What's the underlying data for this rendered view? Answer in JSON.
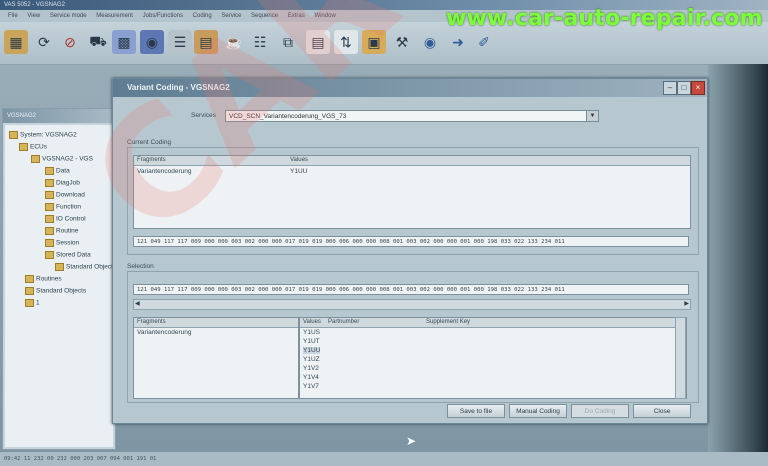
{
  "app": {
    "title": "VAS 5052 - VGSNAG2",
    "menu": [
      "File",
      "View",
      "Service mode",
      "Measurement",
      "Jobs/Functions",
      "Coding",
      "Service",
      "Sequence",
      "Extras",
      "Window"
    ]
  },
  "watermark": {
    "url": "www.car-auto-repair.com",
    "brand": "CARTOOL"
  },
  "tree": {
    "title": "VGSNAG2",
    "nodes": [
      {
        "label": "System: VGSNAG2",
        "depth": 0
      },
      {
        "label": "ECUs",
        "depth": 1
      },
      {
        "label": "VGSNAG2 - VGS",
        "depth": 2
      },
      {
        "label": "Data",
        "depth": 3
      },
      {
        "label": "DiagJob",
        "depth": 3
      },
      {
        "label": "Download",
        "depth": 3
      },
      {
        "label": "Function",
        "depth": 3
      },
      {
        "label": "IO Control",
        "depth": 3
      },
      {
        "label": "Routine",
        "depth": 3
      },
      {
        "label": "Session",
        "depth": 3
      },
      {
        "label": "Stored Data",
        "depth": 3
      },
      {
        "label": "Standard Object",
        "depth": 3
      },
      {
        "label": "Routines",
        "depth": 1
      },
      {
        "label": "Standard Objects",
        "depth": 1
      },
      {
        "label": "1",
        "depth": 1
      }
    ]
  },
  "dialog": {
    "title": "Variant Coding - VGSNAG2",
    "services_label": "Services",
    "services_value": "VCD_SCN_Variantencoderung_VGS_73",
    "current_coding": {
      "label": "Current Coding",
      "headers": [
        "Fragments",
        "Values"
      ],
      "rows": [
        [
          "Variantencoderung",
          "Y1UU"
        ]
      ],
      "hex": "121 049 117 117 009 000 000 003 002 000 000 017 019 019 000 006 000 000 008 001 003 002 000 000 001 000 198 033 022 133 234 011"
    },
    "selection": {
      "label": "Selection",
      "hex": "121 049 117 117 009 000 000 003 002 000 000 017 019 019 000 006 000 000 008 001 003 002 000 000 001 000 198 033 022 133 234 011",
      "fragments_header": "Fragments",
      "fragments": [
        "Variantencoderung"
      ],
      "value_headers": [
        "Values",
        "Partnumber",
        "Supplement Key"
      ],
      "values": [
        "Y1US",
        "Y1UT",
        "Y1UU",
        "Y1UZ",
        "Y1V2",
        "Y1V4",
        "Y1V7"
      ]
    },
    "buttons": {
      "save": "Save to file",
      "manual": "Manual Coding",
      "do_coding": "Do Coding",
      "close": "Close"
    }
  },
  "statusbar": "09:42 11 232 00 232 000 203 007 094 001 191 01",
  "colors": {
    "watermark": "#7cff3a",
    "dialog_title": "#5e7c92",
    "close_button": "#c64a3b"
  }
}
